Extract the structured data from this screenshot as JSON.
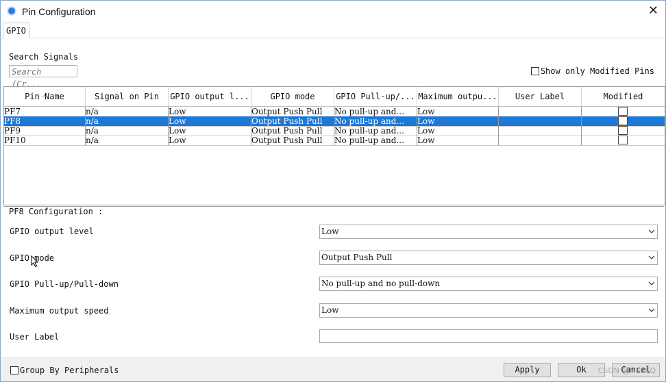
{
  "window": {
    "title": "Pin Configuration",
    "close_glyph": "✕"
  },
  "tab": {
    "label": "GPIO"
  },
  "search": {
    "label": "Search Signals",
    "placeholder": "Search (Cr..."
  },
  "show_only_modified": {
    "label": "Show only Modified Pins",
    "checked": false
  },
  "table": {
    "columns": [
      "Pin Name",
      "Signal on Pin",
      "GPIO output l...",
      "GPIO mode",
      "GPIO Pull-up/...",
      "Maximum outpu...",
      "User Label",
      "Modified"
    ],
    "rows": [
      {
        "pin": "PF7",
        "signal": "n/a",
        "output_level": "Low",
        "mode": "Output Push Pull",
        "pull": "No pull-up and...",
        "speed": "Low",
        "user_label": "",
        "selected": false
      },
      {
        "pin": "PF8",
        "signal": "n/a",
        "output_level": "Low",
        "mode": "Output Push Pull",
        "pull": "No pull-up and...",
        "speed": "Low",
        "user_label": "",
        "selected": true
      },
      {
        "pin": "PF9",
        "signal": "n/a",
        "output_level": "Low",
        "mode": "Output Push Pull",
        "pull": "No pull-up and...",
        "speed": "Low",
        "user_label": "",
        "selected": false
      },
      {
        "pin": "PF10",
        "signal": "n/a",
        "output_level": "Low",
        "mode": "Output Push Pull",
        "pull": "No pull-up and...",
        "speed": "Low",
        "user_label": "",
        "selected": false
      }
    ]
  },
  "config": {
    "title": "PF8 Configuration :",
    "fields": [
      {
        "label": "GPIO output level",
        "value": "Low"
      },
      {
        "label": "GPIO mode",
        "value": "Output Push Pull"
      },
      {
        "label": "GPIO Pull-up/Pull-down",
        "value": "No pull-up and no pull-down"
      },
      {
        "label": "Maximum output speed",
        "value": "Low"
      },
      {
        "label": "User Label",
        "value": ""
      }
    ]
  },
  "footer": {
    "group_by_label": "Group By Peripherals",
    "apply_label": "Apply",
    "ok_label": "Ok",
    "cancel_label": "Cancel",
    "watermark": "CSDN @MSKLQ"
  },
  "colors": {
    "selection": "#1e78d6",
    "accent_icon": "#2b7be0"
  },
  "icons": {
    "app": "app-logo-icon",
    "close": "close-icon",
    "dropdown": "chevron-down-icon",
    "sort": "sort-up-icon",
    "cursor": "mouse-pointer-icon"
  }
}
